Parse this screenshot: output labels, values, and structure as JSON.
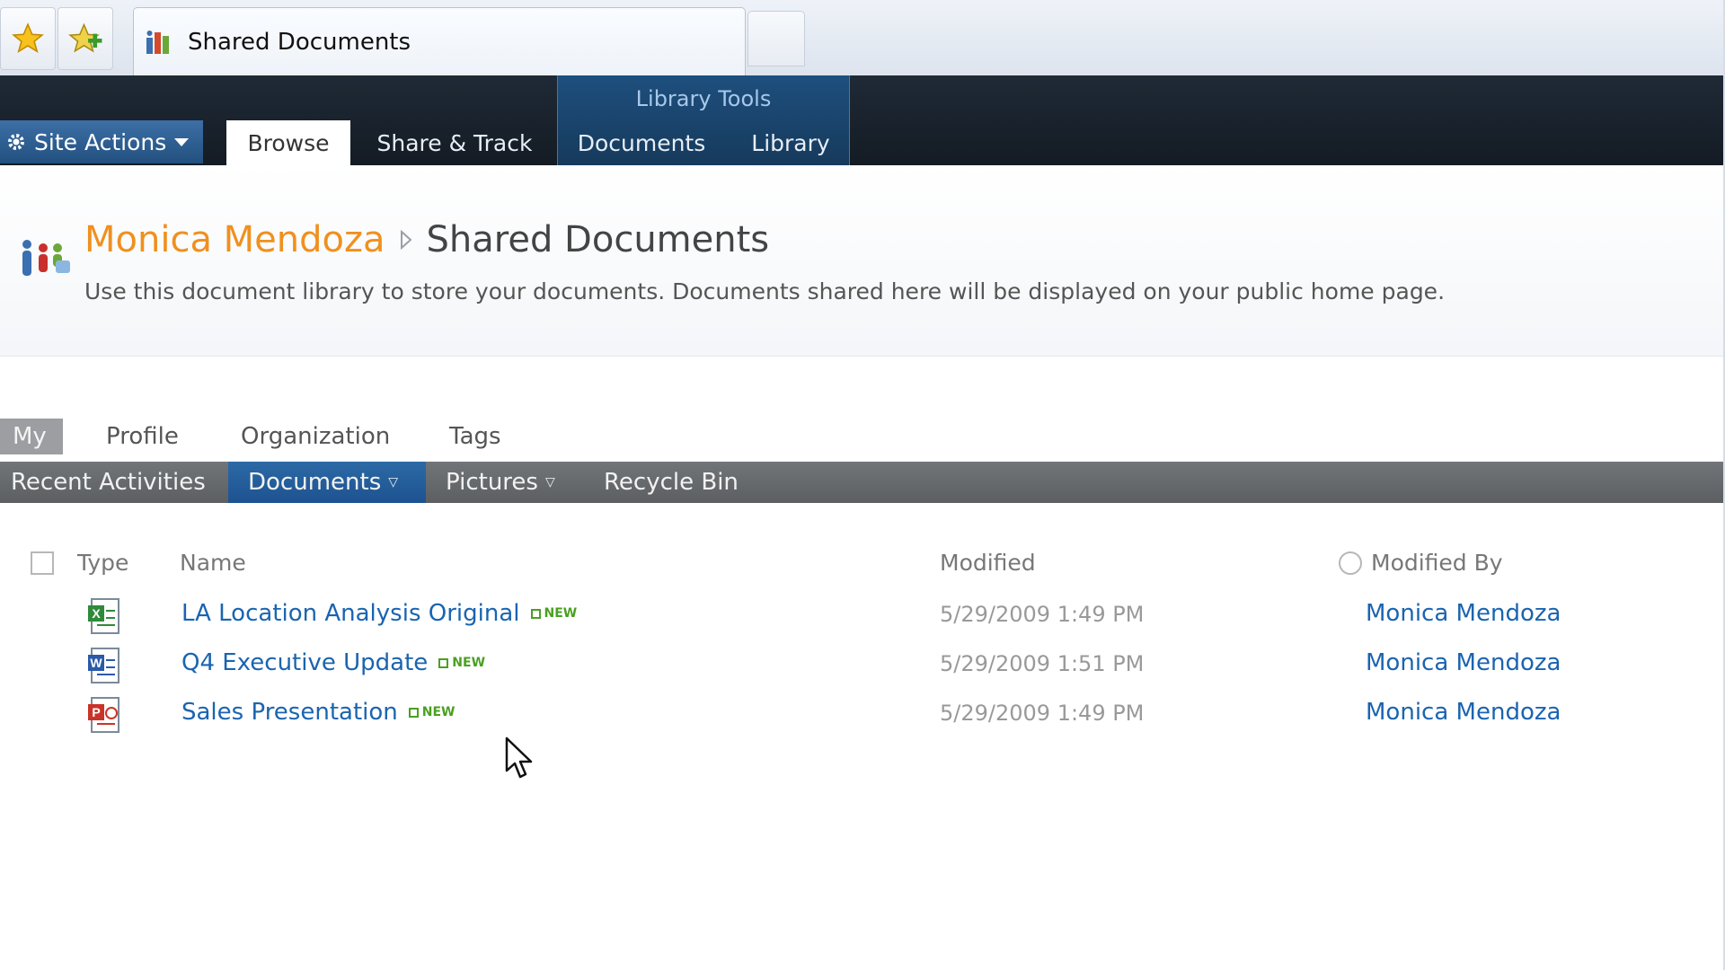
{
  "browser": {
    "tab_title": "Shared Documents"
  },
  "ribbon": {
    "site_actions": "Site Actions",
    "tabs": [
      {
        "label": "Browse"
      },
      {
        "label": "Share & Track"
      }
    ],
    "contextual_group": "Library Tools",
    "contextual_tabs": [
      {
        "label": "Documents"
      },
      {
        "label": "Library"
      }
    ]
  },
  "header": {
    "site_title": "Monica Mendoza",
    "page_title": "Shared Documents",
    "description": "Use this document library to store your documents. Documents shared here will be displayed on your public home page."
  },
  "mysite_nav": {
    "items": [
      {
        "label": "My"
      },
      {
        "label": "Profile"
      },
      {
        "label": "Organization"
      },
      {
        "label": "Tags"
      }
    ]
  },
  "subnav": {
    "items": [
      {
        "label": "Recent Activities"
      },
      {
        "label": "Documents"
      },
      {
        "label": "Pictures"
      },
      {
        "label": "Recycle Bin"
      }
    ]
  },
  "list": {
    "columns": {
      "type": "Type",
      "name": "Name",
      "modified": "Modified",
      "modified_by": "Modified By"
    },
    "new_badge": "NEW",
    "rows": [
      {
        "icon": "excel-file-icon",
        "name": "LA Location Analysis Original",
        "modified": "5/29/2009 1:49 PM",
        "modified_by": "Monica Mendoza"
      },
      {
        "icon": "word-file-icon",
        "name": "Q4 Executive Update",
        "modified": "5/29/2009 1:51 PM",
        "modified_by": "Monica Mendoza"
      },
      {
        "icon": "powerpoint-file-icon",
        "name": "Sales Presentation",
        "modified": "5/29/2009 1:49 PM",
        "modified_by": "Monica Mendoza"
      }
    ]
  },
  "colors": {
    "site_title": "#f0901e",
    "link": "#1a64b0",
    "ribbon_bg": "#141b24",
    "active_subnav": "#1d5290",
    "new_badge": "#4aa020"
  }
}
